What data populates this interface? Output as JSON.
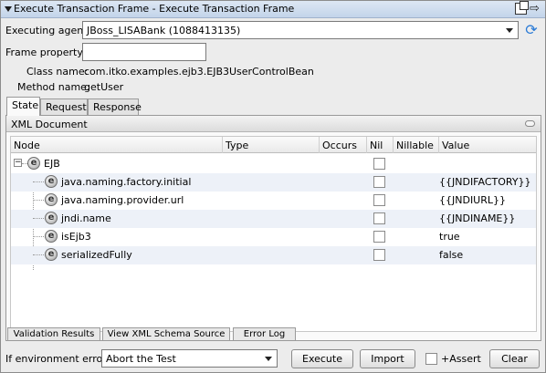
{
  "window": {
    "title": "Execute Transaction Frame - Execute Transaction Frame"
  },
  "form": {
    "executing_agent_label": "Executing agent:",
    "executing_agent_value": "JBoss_LISABank (1088413135)",
    "frame_property_label": "Frame property:",
    "frame_property_value": "",
    "class_name_label": "Class name:",
    "class_name_value": "com.itko.examples.ejb3.EJB3UserControlBean",
    "method_name_label": "Method name:",
    "method_name_value": "getUser"
  },
  "tabs": [
    {
      "label": "State",
      "active": true
    },
    {
      "label": "Request",
      "active": false
    },
    {
      "label": "Response",
      "active": false
    }
  ],
  "panel": {
    "title": "XML Document"
  },
  "table": {
    "columns": [
      "Node",
      "Type",
      "Occurs",
      "Nil",
      "Nillable",
      "Value"
    ],
    "rows": [
      {
        "node": "EJB",
        "type": "",
        "occurs": "",
        "nil": false,
        "nillable": "",
        "value": "",
        "level": 0,
        "expanded": true
      },
      {
        "node": "java.naming.factory.initial",
        "type": "",
        "occurs": "",
        "nil": false,
        "nillable": "",
        "value": "{{JNDIFACTORY}}",
        "level": 1
      },
      {
        "node": "java.naming.provider.url",
        "type": "",
        "occurs": "",
        "nil": false,
        "nillable": "",
        "value": "{{JNDIURL}}",
        "level": 1
      },
      {
        "node": "jndi.name",
        "type": "",
        "occurs": "",
        "nil": false,
        "nillable": "",
        "value": "{{JNDINAME}}",
        "level": 1
      },
      {
        "node": "isEjb3",
        "type": "",
        "occurs": "",
        "nil": false,
        "nillable": "",
        "value": "true",
        "level": 1
      },
      {
        "node": "serializedFully",
        "type": "",
        "occurs": "",
        "nil": false,
        "nillable": "",
        "value": "false",
        "level": 1
      }
    ]
  },
  "subtabs": [
    "Validation Results",
    "View XML Schema Source",
    "Error Log"
  ],
  "footer": {
    "env_error_label": "If environment error:",
    "env_error_value": "Abort the Test",
    "execute_label": "Execute",
    "import_label": "Import",
    "assert_label": "+Assert",
    "clear_label": "Clear"
  },
  "colors": {
    "titlebar": "#c3d4ea",
    "alt_row": "#edf1f8",
    "refresh_icon": "#2b7bd6"
  }
}
